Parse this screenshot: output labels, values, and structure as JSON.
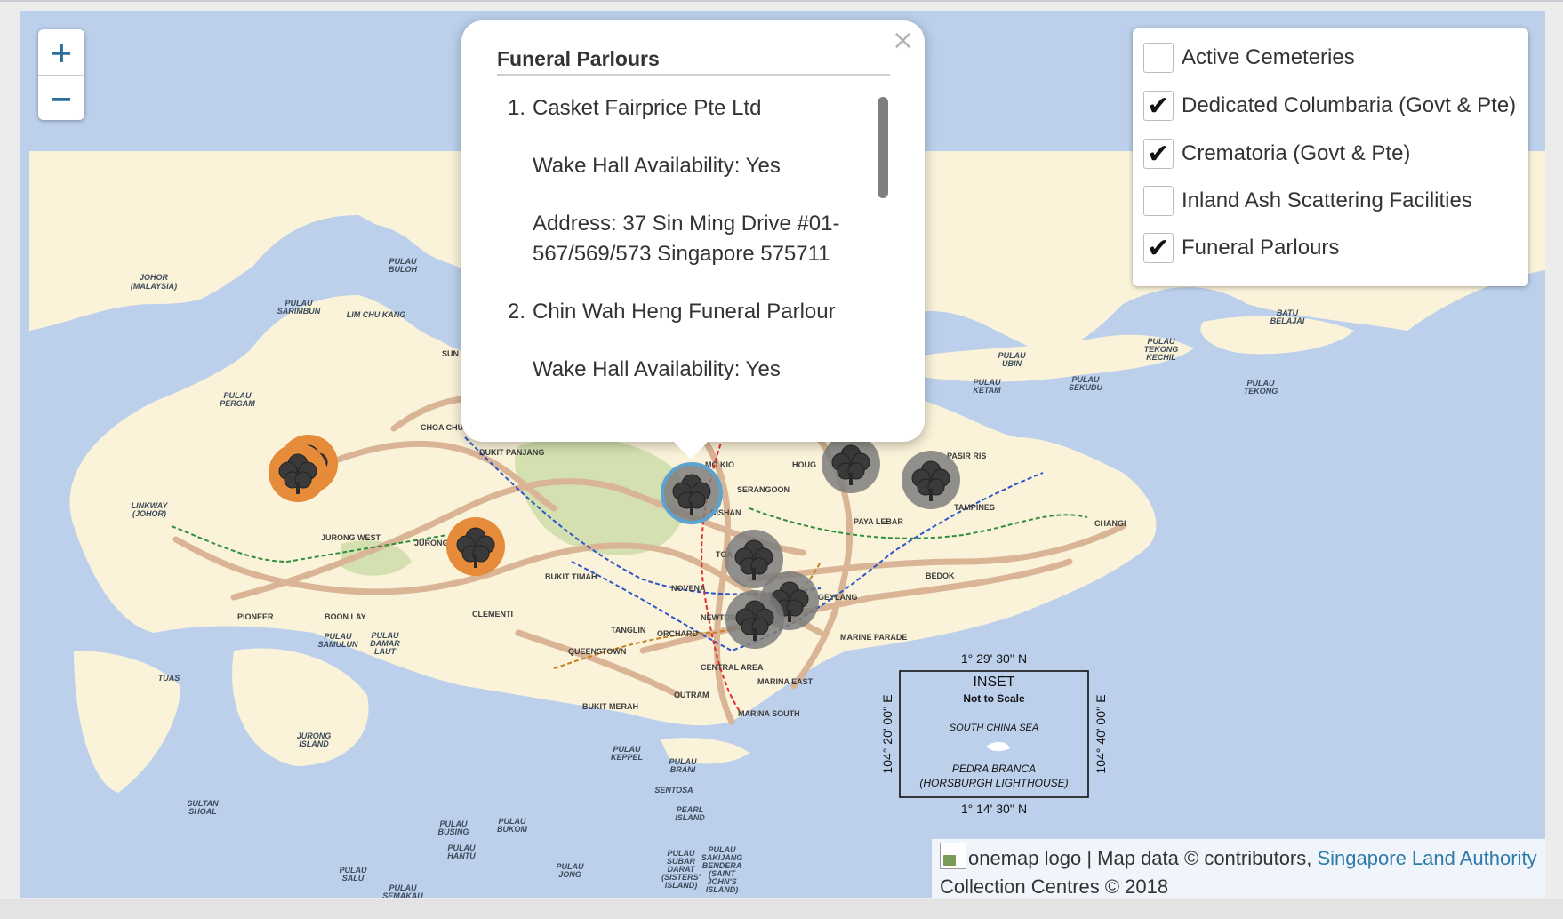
{
  "zoom": {
    "in_label": "+",
    "out_label": "−"
  },
  "popup": {
    "title": "Funeral Parlours",
    "close_label": "×",
    "entries": [
      {
        "number": "1.",
        "name": "Casket Fairprice Pte Ltd",
        "wake_hall": "Wake Hall Availability: Yes",
        "address": "Address: 37 Sin Ming Drive #01-567/569/573 Singapore 575711"
      },
      {
        "number": "2.",
        "name": "Chin Wah Heng Funeral Parlour",
        "wake_hall": "Wake Hall Availability: Yes"
      }
    ]
  },
  "layers": [
    {
      "label": "Active Cemeteries",
      "checked": false
    },
    {
      "label": "Dedicated Columbaria (Govt & Pte)",
      "checked": true
    },
    {
      "label": "Crematoria (Govt & Pte)",
      "checked": true
    },
    {
      "label": "Inland Ash Scattering Facilities",
      "checked": false
    },
    {
      "label": "Funeral Parlours",
      "checked": true
    }
  ],
  "checkmark": "✔",
  "attribution": {
    "logo_alt": "onemap logo",
    "text": " | Map data © contributors, ",
    "link": "Singapore Land Authority",
    "line2": "Collection Centres © 2018"
  },
  "map_labels": {
    "places": [
      "JOHOR",
      "(MALAYSIA)",
      "PULAU",
      "BULOH",
      "SARIMBUN",
      "LIM CHU KANG",
      "PERGAM",
      "LINKWAY",
      "(JOHOR)",
      "UBIN",
      "KETAM",
      "SEKUDU",
      "TEKONG",
      "KECHIL",
      "BATU",
      "BELAJAI",
      "TUAS",
      "JURONG",
      "ISLAND",
      "SULTAN",
      "SHOAL",
      "BUSING",
      "BUKOM",
      "HANTU",
      "SALU",
      "KEPPEL",
      "BRANI",
      "SENTOSA",
      "PEARL",
      "SUBAR",
      "DARAT",
      "(SISTERS'",
      "ISLAND)",
      "SAKIJANG",
      "BENDERA",
      "(SAINT",
      "JOHN'S",
      "JONG",
      "SEMAKAU",
      "SAMULUN",
      "DAMAR",
      "LAUT"
    ],
    "districts": [
      "SUN",
      "CHOA CHU",
      "BUKIT PANJANG",
      "MO KIO",
      "HOUG",
      "PASIR RIS",
      "SERANGOON",
      "BISHAN",
      "PAYA LEBAR",
      "TAMPINES",
      "CHANGI",
      "JURONG WEST",
      "JURONG",
      "BUKIT TIMAH",
      "NOVENA",
      "TOA",
      "BEDOK",
      "PIONEER",
      "BOON LAY",
      "CLEMENTI",
      "TANGLIN",
      "NEWTON",
      "ORCHARD",
      "GEYLANG",
      "MARINE PARADE",
      "QUEENSTOWN",
      "CENTRAL AREA",
      "MARINA EAST",
      "OUTRAM",
      "BUKIT MERAH",
      "MARINA SOUTH"
    ]
  },
  "inset": {
    "title": "INSET",
    "subtitle": "Not to Scale",
    "sea": "SOUTH CHINA SEA",
    "place1": "PEDRA BRANCA",
    "place2": "(HORSBURGH LIGHTHOUSE)",
    "top_coord": "1° 29' 30'' N",
    "bottom_coord": "1° 14' 30'' N",
    "left_coord": "104° 20' 00'' E",
    "right_coord": "104° 40' 00'' E"
  },
  "colors": {
    "sea": "#bcd0ec",
    "land": "#faf3d9",
    "park": "#d4e0b0",
    "road": "#d9b595",
    "marker_orange": "#e58b3a",
    "marker_grey": "#7d7d7d",
    "marker_selected_ring": "#5ba3d0"
  }
}
